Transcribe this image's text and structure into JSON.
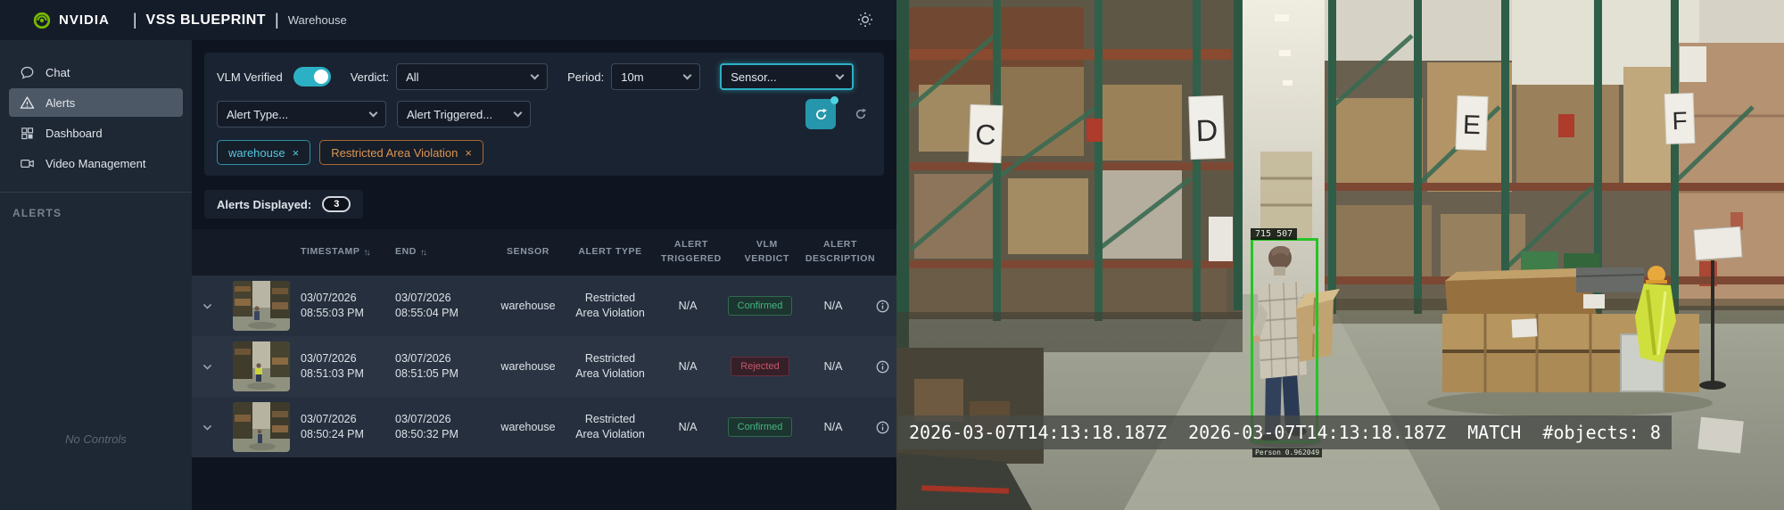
{
  "topbar": {
    "brand": "NVIDIA",
    "app_title": "VSS BLUEPRINT",
    "page_title": "Warehouse"
  },
  "sidebar": {
    "items": [
      {
        "label": "Chat"
      },
      {
        "label": "Alerts"
      },
      {
        "label": "Dashboard"
      },
      {
        "label": "Video Management"
      }
    ],
    "section_header": "ALERTS",
    "footer_note": "No Controls"
  },
  "filters": {
    "vlm_verified_label": "VLM Verified",
    "verdict_label": "Verdict:",
    "verdict_value": "All",
    "period_label": "Period:",
    "period_value": "10m",
    "sensor_placeholder": "Sensor...",
    "alert_type_placeholder": "Alert Type...",
    "alert_triggered_placeholder": "Alert Triggered...",
    "tags": [
      {
        "label": "warehouse",
        "dismiss": "×"
      },
      {
        "label": "Restricted Area Violation",
        "dismiss": "×"
      }
    ]
  },
  "alerts_summary": {
    "label": "Alerts Displayed:",
    "count": "3"
  },
  "table": {
    "headers": {
      "timestamp": "TIMESTAMP",
      "end": "END",
      "sensor": "SENSOR",
      "alert_type": "ALERT TYPE",
      "alert_triggered": "ALERT TRIGGERED",
      "vlm_verdict": "VLM VERDICT",
      "alert_description": "ALERT DESCRIPTION"
    },
    "sort_glyph": "↑↓",
    "rows": [
      {
        "start_date": "03/07/2026",
        "start_time": "08:55:03 PM",
        "end_date": "03/07/2026",
        "end_time": "08:55:04 PM",
        "sensor": "warehouse",
        "alert_type": "Restricted Area Violation",
        "alert_triggered": "N/A",
        "vlm_verdict": "Confirmed",
        "vlm_verdict_status": "confirmed",
        "alert_description": "N/A"
      },
      {
        "start_date": "03/07/2026",
        "start_time": "08:51:03 PM",
        "end_date": "03/07/2026",
        "end_time": "08:51:05 PM",
        "sensor": "warehouse",
        "alert_type": "Restricted Area Violation",
        "alert_triggered": "N/A",
        "vlm_verdict": "Rejected",
        "vlm_verdict_status": "rejected",
        "alert_description": "N/A"
      },
      {
        "start_date": "03/07/2026",
        "start_time": "08:50:24 PM",
        "end_date": "03/07/2026",
        "end_time": "08:50:32 PM",
        "sensor": "warehouse",
        "alert_type": "Restricted Area Violation",
        "alert_triggered": "N/A",
        "vlm_verdict": "Confirmed",
        "vlm_verdict_status": "confirmed",
        "alert_description": "N/A"
      }
    ]
  },
  "video": {
    "rack_signs": [
      "C",
      "D",
      "E",
      "F"
    ],
    "bbox_label": "715 507",
    "detection_label": "Person 0.962049",
    "overlay_text": "2026-03-07T14:13:18.187Z  2026-03-07T14:13:18.187Z  MATCH  #objects: 8"
  },
  "colors": {
    "accent_teal": "#2cb0c4",
    "confirmed_green": "#43b581",
    "rejected_red": "#c5566b",
    "bbox_green": "#27c327",
    "tag_cyan": "#53c6dd",
    "tag_orange": "#dd9550",
    "nvidia_green": "#76b900"
  }
}
